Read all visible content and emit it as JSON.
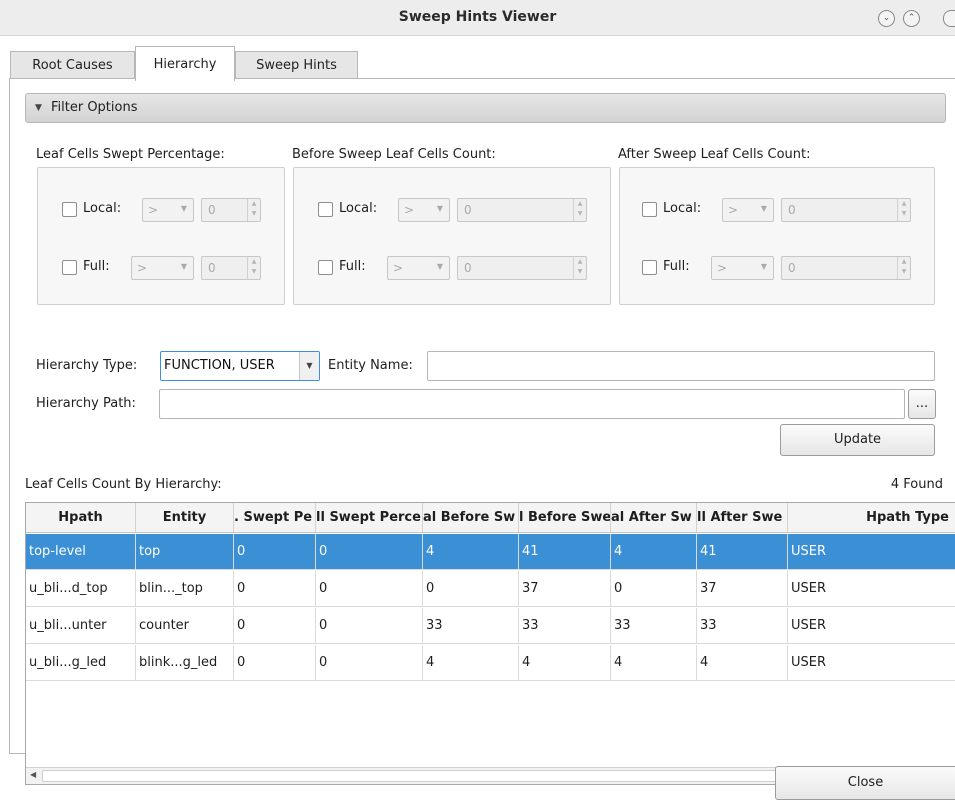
{
  "window": {
    "title": "Sweep Hints Viewer",
    "minimize_glyph": "⌄",
    "maximize_glyph": "⌃",
    "close_glyph": "×"
  },
  "tabs": [
    {
      "label": "Root Causes",
      "active": false
    },
    {
      "label": "Hierarchy",
      "active": true
    },
    {
      "label": "Sweep Hints",
      "active": false
    }
  ],
  "filter": {
    "header": "Filter Options",
    "groups": [
      {
        "label": "Leaf Cells Swept Percentage:",
        "rows": [
          {
            "label": "Local:",
            "operator": ">",
            "value": "0"
          },
          {
            "label": "Full:",
            "operator": ">",
            "value": "0"
          }
        ]
      },
      {
        "label": "Before Sweep Leaf Cells Count:",
        "rows": [
          {
            "label": "Local:",
            "operator": ">",
            "value": "0"
          },
          {
            "label": "Full:",
            "operator": ">",
            "value": "0"
          }
        ]
      },
      {
        "label": "After Sweep Leaf Cells Count:",
        "rows": [
          {
            "label": "Local:",
            "operator": ">",
            "value": "0"
          },
          {
            "label": "Full:",
            "operator": ">",
            "value": "0"
          }
        ]
      }
    ],
    "hierarchy_type_label": "Hierarchy Type:",
    "hierarchy_type_value": "FUNCTION, USER",
    "entity_name_label": "Entity Name:",
    "entity_name_value": "",
    "hierarchy_path_label": "Hierarchy Path:",
    "hierarchy_path_value": "",
    "browse_label": "...",
    "update_label": "Update"
  },
  "table": {
    "label": "Leaf Cells Count By Hierarchy:",
    "found": "4 Found",
    "columns": [
      ". Swept Pe",
      "ll Swept Perce",
      "al Before Sw",
      "l Before Swe",
      "al After Sw",
      "ll After Swe"
    ],
    "col_hpath": "Hpath",
    "col_entity": "Entity",
    "col_hpath_type": "Hpath Type",
    "rows": [
      {
        "hpath": "top-level",
        "entity": "top",
        "c1": "0",
        "c2": "0",
        "c3": "4",
        "c4": "41",
        "c5": "4",
        "c6": "41",
        "type": "USER"
      },
      {
        "hpath": "u_bli...d_top",
        "entity": "blin..._top",
        "c1": "0",
        "c2": "0",
        "c3": "0",
        "c4": "37",
        "c5": "0",
        "c6": "37",
        "type": "USER"
      },
      {
        "hpath": "u_bli...unter",
        "entity": "counter",
        "c1": "0",
        "c2": "0",
        "c3": "33",
        "c4": "33",
        "c5": "33",
        "c6": "33",
        "type": "USER"
      },
      {
        "hpath": "u_bli...g_led",
        "entity": "blink...g_led",
        "c1": "0",
        "c2": "0",
        "c3": "4",
        "c4": "4",
        "c5": "4",
        "c6": "4",
        "type": "USER"
      }
    ]
  },
  "footer": {
    "close_label": "Close"
  },
  "colors": {
    "selection": "#3b8fd4",
    "focus_border": "#3d8ee0"
  }
}
